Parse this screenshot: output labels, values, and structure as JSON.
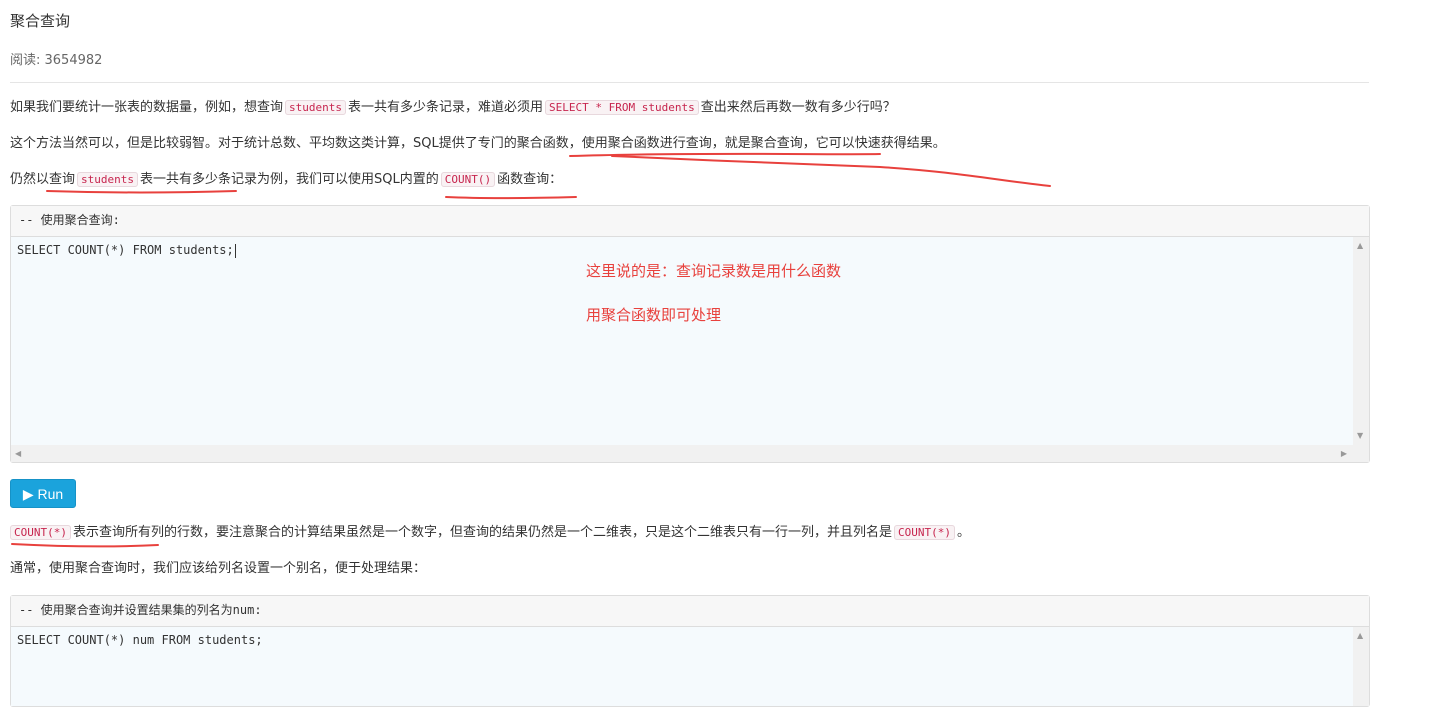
{
  "page": {
    "title": "聚合查询",
    "reads_label": "阅读: 3654982"
  },
  "para1": {
    "t1": "如果我们要统计一张表的数据量，例如，想查询",
    "c1": "students",
    "t2": "表一共有多少条记录，难道必须用",
    "c2": "SELECT * FROM students",
    "t3": "查出来然后再数一数有多少行吗？"
  },
  "para2": {
    "t1": "这个方法当然可以，但是比较弱智。对于统计总数、平均数这类计算，SQL提供了专门的聚合函数，使用聚合函数进行查询，就是聚合查询，它可以快速获得结果。"
  },
  "para3": {
    "t1": "仍然以查询",
    "c1": "students",
    "t2": "表一共有多少条记录为例，我们可以使用SQL内置的",
    "c2": "COUNT()",
    "t3": "函数查询："
  },
  "code1": {
    "header": "-- 使用聚合查询:",
    "code": "SELECT COUNT(*) FROM students;"
  },
  "notes": {
    "note1": "这里说的是：查询记录数是用什么函数",
    "note2": "用聚合函数即可处理"
  },
  "run_button": {
    "icon": "play-icon",
    "label": "Run"
  },
  "para4": {
    "c1": "COUNT(*)",
    "t1": "表示查询所有列的行数，要注意聚合的计算结果虽然是一个数字，但查询的结果仍然是一个二维表，只是这个二维表只有一行一列，并且列名是",
    "c2": "COUNT(*)",
    "t2": "。"
  },
  "para5": {
    "t1": "通常，使用聚合查询时，我们应该给列名设置一个别名，便于处理结果："
  },
  "code2": {
    "header": "-- 使用聚合查询并设置结果集的列名为num:",
    "code": "SELECT COUNT(*) num FROM students;"
  },
  "colors": {
    "annotation": "#e8413d",
    "run_button": "#1ba3dc",
    "code_text": "#c7254e"
  }
}
